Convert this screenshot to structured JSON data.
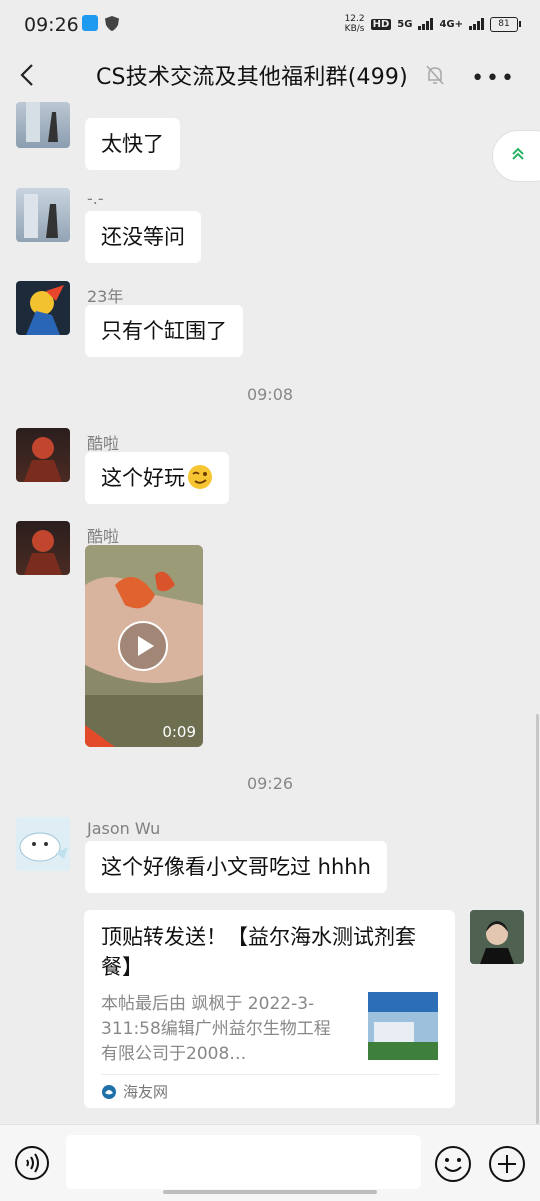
{
  "status": {
    "time": "09:26",
    "net_speed_value": "12.2",
    "net_speed_unit": "KB/s",
    "hd": "HD",
    "g5": "5G",
    "g4": "4G+",
    "battery": "81"
  },
  "header": {
    "title": "CS技术交流及其他福利群(499)"
  },
  "messages": {
    "m1": {
      "text": "太快了"
    },
    "m2": {
      "sender": "-.-",
      "text": "还没等问"
    },
    "m3": {
      "sender": "23年",
      "text": "只有个缸围了"
    },
    "t1": "09:08",
    "m4": {
      "sender": "酷啦",
      "text": "这个好玩"
    },
    "m5": {
      "sender": "酷啦",
      "video_duration": "0:09"
    },
    "t2": "09:26",
    "m6": {
      "sender": "Jason Wu",
      "text": "这个好像看小文哥吃过 hhhh"
    },
    "m7": {
      "card_title": "顶贴转发送！【益尔海水测试剂套餐】",
      "card_desc": "本帖最后由 飒枫于 2022-3-311:58编辑广州益尔生物工程有限公司于2008…",
      "card_source": "海友网"
    }
  },
  "input": {
    "placeholder": ""
  },
  "colors": {
    "background": "#ededed",
    "bubble": "#ffffff",
    "meta_text": "#888888"
  }
}
